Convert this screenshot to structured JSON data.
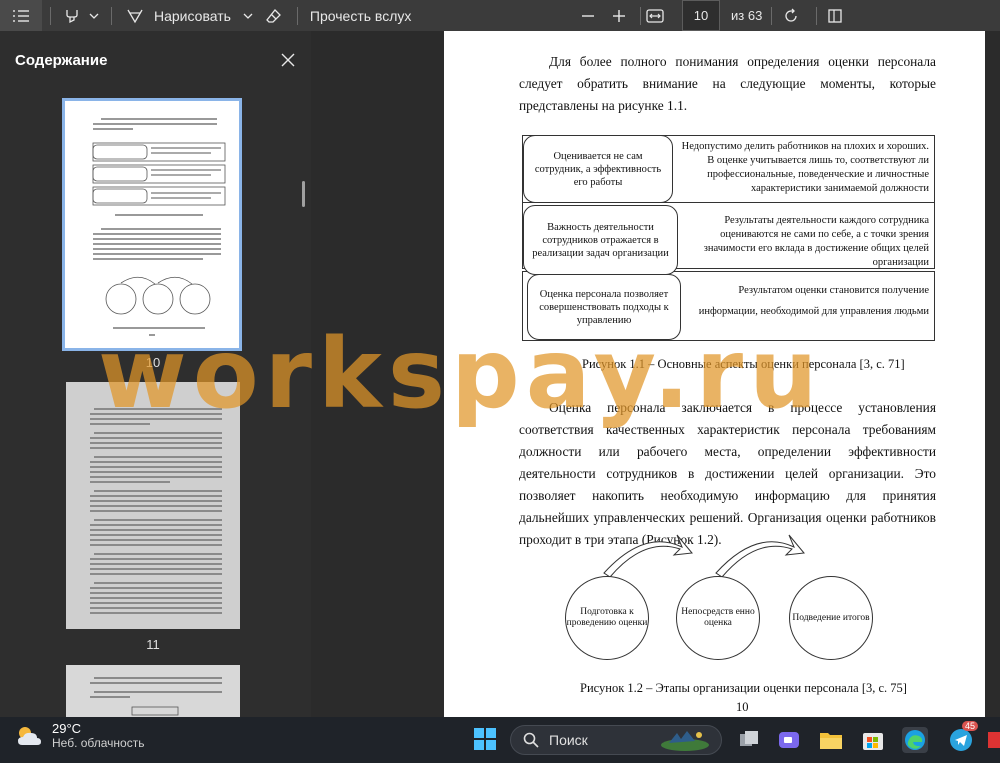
{
  "toolbar": {
    "draw_label": "Нарисовать",
    "read_aloud_label": "Прочесть вслух",
    "page_number": "10",
    "page_total": "из 63"
  },
  "sidebar": {
    "title": "Содержание",
    "thumbs": [
      {
        "number": "10",
        "selected": true
      },
      {
        "number": "11",
        "selected": false
      }
    ]
  },
  "page": {
    "para1": "Для более полного понимания определения оценки персонала следует обратить внимание на следующие моменты, которые представлены на рисунке 1.1.",
    "table": [
      {
        "left": "Оценивается не сам сотрудник, а эффективность его работы",
        "right": "Недопустимо делить работников на плохих и хороших. В оценке учитывается лишь то, соответствуют ли профессиональные, поведенческие и личностные характеристики занимаемой должности"
      },
      {
        "left": "Важность деятельности сотрудников отражается в реализации задач организации",
        "right": "Результаты деятельности каждого сотрудника оцениваются не сами по себе, а с точки зрения значимости его вклада в достижение общих целей организации"
      },
      {
        "left": "Оценка персонала позволяет совершенствовать подходы к управлению",
        "right_line1": "Результатом оценки становится получение",
        "right_line2": "информации, необходимой для управления людьми"
      }
    ],
    "caption1": "Рисунок 1.1 – Основные аспекты оценки персонала [3, с. 71]",
    "para2": "Оценка персонала заключается в процессе установления соответствия качественных характеристик персонала требованиям должности или рабочего места, определении эффективности деятельности сотрудников в достижении целей организации. Это позволяет накопить необходимую информацию для принятия дальнейших управленческих решений. Организация оценки работников проходит в три этапа (Рисунок 1.2).",
    "circles": [
      "Подготовка к проведению оценки",
      "Непосредств енно оценка",
      "Подведение итогов"
    ],
    "caption2": "Рисунок 1.2 – Этапы организации оценки персонала [3, с. 75]",
    "page_num": "10"
  },
  "watermark": "workspay.ru",
  "taskbar": {
    "temperature": "29°C",
    "weather": "Неб. облачность",
    "search_label": "Поиск",
    "badge": "45"
  },
  "colors": {
    "toolbar_bg": "#3b3b3b",
    "sidebar_bg": "#2e2e2e",
    "accent_selected": "#8ab4e8",
    "watermark": "#e19628"
  }
}
